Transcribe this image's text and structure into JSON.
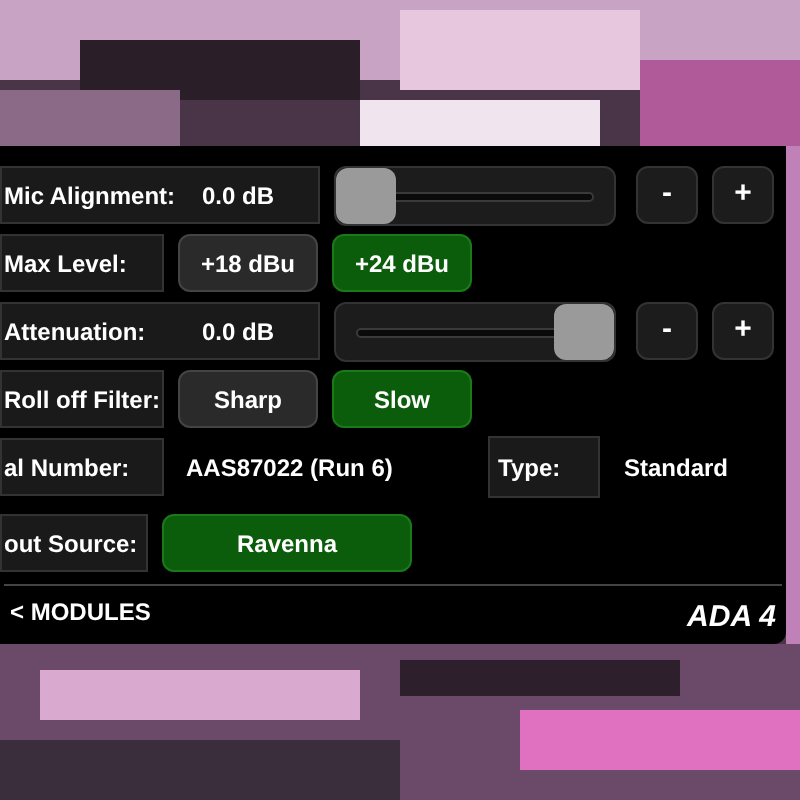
{
  "rows": [
    {
      "kind": "slider",
      "label": "Mic Alignment:",
      "value": "0.0 dB",
      "level": 0,
      "minus": "-",
      "plus": "+"
    },
    {
      "kind": "choice",
      "label": "Max Level:",
      "options": [
        {
          "label": "+18 dBu",
          "selected": false
        },
        {
          "label": "+24 dBu",
          "selected": true
        }
      ]
    },
    {
      "kind": "slider",
      "label": "Attenuation:",
      "value": "0.0 dB",
      "level": 1,
      "minus": "-",
      "plus": "+"
    },
    {
      "kind": "choice",
      "label": "Roll off Filter:",
      "options": [
        {
          "label": "Sharp",
          "selected": false
        },
        {
          "label": "Slow",
          "selected": true
        }
      ]
    },
    {
      "kind": "info",
      "label": "al Number:",
      "value": "AAS87022 (Run 6)",
      "label2": "Type:",
      "value2": "Standard"
    },
    {
      "kind": "choice",
      "label": "out Source:",
      "options": [
        {
          "label": "Ravenna",
          "selected": true
        }
      ]
    }
  ],
  "footer": {
    "back": "< MODULES",
    "title": "ADA 4"
  }
}
